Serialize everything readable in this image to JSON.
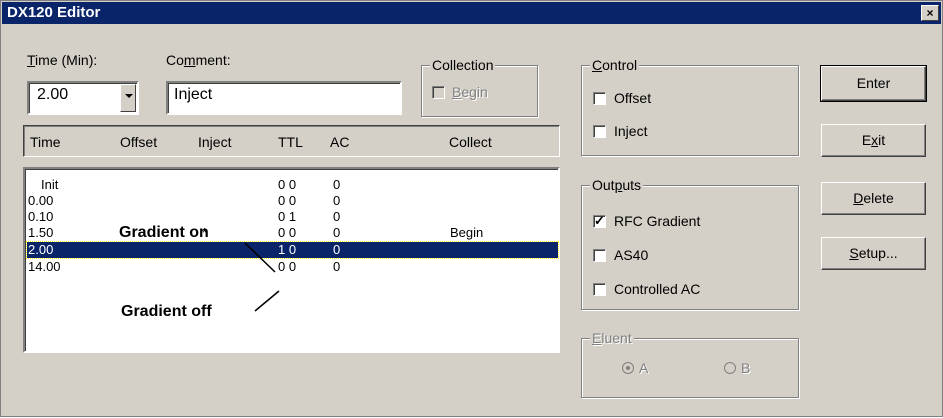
{
  "window": {
    "title": "DX120 Editor",
    "close_glyph": "×"
  },
  "time_field": {
    "label_u": "T",
    "label_rest": "ime (Min):",
    "value": "2.00"
  },
  "comment_field": {
    "label_a": "Co",
    "label_u": "m",
    "label_b": "ment:",
    "value": "Inject"
  },
  "collection": {
    "title": "Collection",
    "begin_u": "B",
    "begin_rest": "egin"
  },
  "table": {
    "headers": [
      "Time",
      "Offset",
      "Inject",
      "TTL",
      "AC",
      "Collect"
    ],
    "rows": [
      {
        "time": "Init",
        "inject": "",
        "ttl": "0 0",
        "ac": "0",
        "collect": ""
      },
      {
        "time": "0.00",
        "inject": "",
        "ttl": "0 0",
        "ac": "0",
        "collect": ""
      },
      {
        "time": "0.10",
        "inject": "",
        "ttl": "0 1",
        "ac": "0",
        "collect": ""
      },
      {
        "time": "1.50",
        "inject": "*",
        "ttl": "0 0",
        "ac": "0",
        "collect": "Begin"
      },
      {
        "time": "2.00",
        "inject": "",
        "ttl": "1 0",
        "ac": "0",
        "collect": "",
        "selected": true
      },
      {
        "time": "14.00",
        "inject": "",
        "ttl": "0 0",
        "ac": "0",
        "collect": ""
      }
    ]
  },
  "annotations": {
    "gradient_on": "Gradient on",
    "gradient_off": "Gradient off"
  },
  "control": {
    "title_u": "C",
    "title_rest": "ontrol",
    "offset": {
      "label": "Offset",
      "checked": false
    },
    "inject": {
      "label": "Inject",
      "checked": false
    }
  },
  "outputs": {
    "title_a": "Out",
    "title_u": "p",
    "title_b": "uts",
    "rfc_gradient": {
      "label": "RFC Gradient",
      "checked": true
    },
    "as40": {
      "label": "AS40",
      "checked": false
    },
    "controlled_ac": {
      "label": "Controlled AC",
      "checked": false
    }
  },
  "eluent": {
    "title_u": "E",
    "title_rest": "luent",
    "a": "A",
    "b": "B",
    "selected": "A"
  },
  "buttons": {
    "enter": "Enter",
    "exit_a": "E",
    "exit_u": "x",
    "exit_b": "it",
    "delete_u": "D",
    "delete_rest": "elete",
    "setup_u": "S",
    "setup_rest": "etup..."
  },
  "colors": {
    "titlebar": "#0a246a",
    "face": "#d4d0c8",
    "selection": "#0a246a"
  }
}
